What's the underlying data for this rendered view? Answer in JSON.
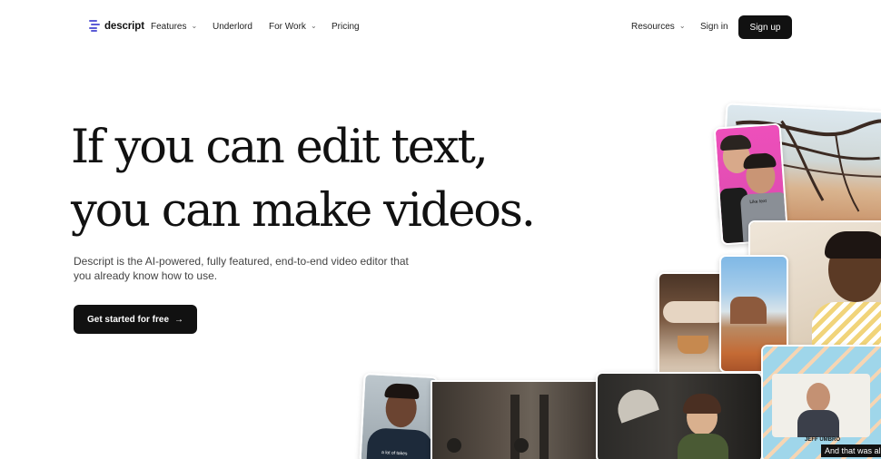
{
  "nav": {
    "logo_text": "descript",
    "features": "Features",
    "underlord": "Underlord",
    "for_work": "For Work",
    "pricing": "Pricing",
    "resources": "Resources",
    "sign_in": "Sign in",
    "sign_up": "Sign up"
  },
  "hero": {
    "headline_line1": "If you can edit text,",
    "headline_line2": "you can make videos.",
    "subtitle": "Descript is the AI-powered, fully featured, end-to-end video editor that you already know how to use.",
    "cta_label": "Get started for free",
    "cta_arrow": "→"
  },
  "collage": {
    "shirt_text": "Like text",
    "caption_small": "a lot of takes",
    "name_tag": "JEFF UMBRO",
    "subtitle_text": "And that was all"
  },
  "colors": {
    "brand": "#5b5bd6",
    "button": "#111111",
    "pink": "#e94fb6",
    "sky": "#8fc7e8"
  }
}
